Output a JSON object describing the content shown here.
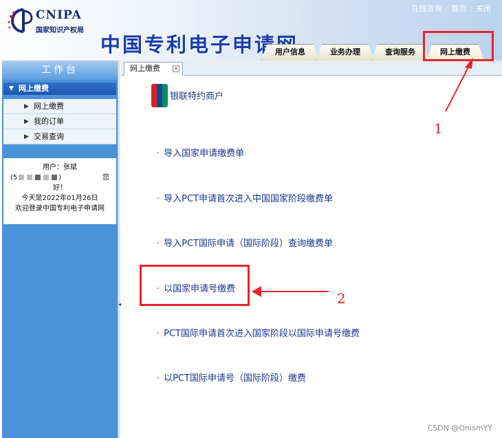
{
  "header": {
    "logo_en": "CNIPA",
    "logo_cn": "国家知识产权局",
    "site_title": "中国专利电子申请网",
    "top_links": [
      "在线咨询",
      "首页",
      "关闭"
    ],
    "tabs": [
      "用户信息",
      "业务办理",
      "查询服务",
      "网上缴费"
    ]
  },
  "sidebar": {
    "heading": "工作台",
    "group_label": "网上缴费",
    "items": [
      "网上缴费",
      "我的订单",
      "交易查询"
    ],
    "user": {
      "label": "用户：张斌",
      "id_prefix": "(5",
      "greeting_a": "您",
      "greeting_b": "好！",
      "date_line": "今天是2022年01月26日",
      "welcome": "欢迎登录中国专利电子申请网"
    }
  },
  "main": {
    "tab_label": "网上缴费",
    "tab_close": "×",
    "unionpay_text": "银联特约商户",
    "links": [
      "导入国家申请缴费单",
      "导入PCT申请首次进入中国国家阶段缴费单",
      "导入PCT国际申请（国际阶段）查询缴费单",
      "以国家申请号缴费",
      "PCT国际申请首次进入国家阶段以国际申请号缴费",
      "以PCT国际申请号（国际阶段）缴费"
    ]
  },
  "annotations": {
    "label_1": "1",
    "label_2": "2",
    "color": "#e8242a"
  },
  "watermark": "CSDN @OnismYY"
}
